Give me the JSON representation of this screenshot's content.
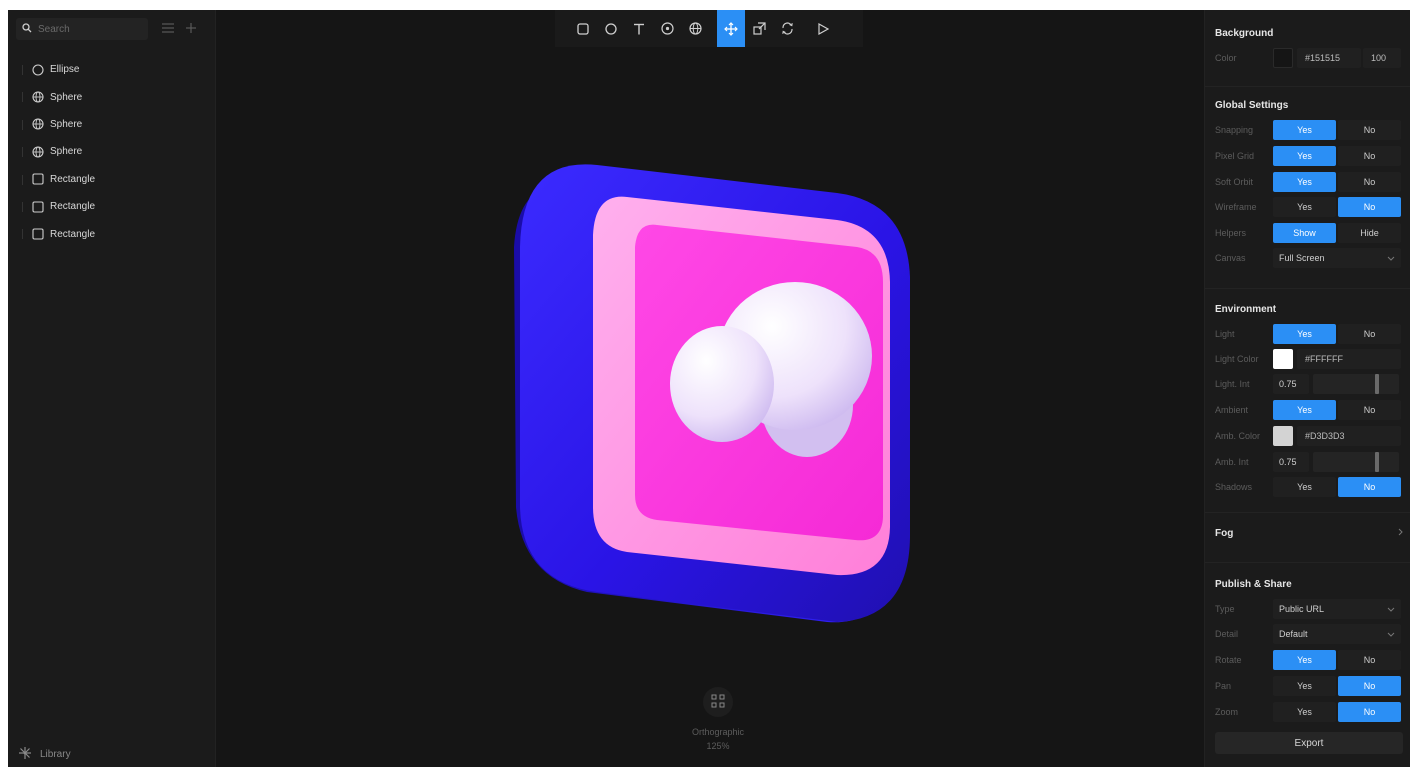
{
  "left_panel": {
    "search_placeholder": "Search",
    "layers": [
      {
        "label": "Ellipse",
        "icon": "ellipse-icon"
      },
      {
        "label": "Sphere",
        "icon": "sphere-icon"
      },
      {
        "label": "Sphere",
        "icon": "sphere-icon"
      },
      {
        "label": "Sphere",
        "icon": "sphere-icon"
      },
      {
        "label": "Rectangle",
        "icon": "rectangle-icon"
      },
      {
        "label": "Rectangle",
        "icon": "rectangle-icon"
      },
      {
        "label": "Rectangle",
        "icon": "rectangle-icon"
      }
    ],
    "library_label": "Library"
  },
  "toolbar": {
    "tools": [
      "rectangle-tool-icon",
      "ellipse-tool-icon",
      "text-tool-icon",
      "sphere-tool-icon",
      "globe-tool-icon",
      "move-tool-icon",
      "scale-tool-icon",
      "rotate-tool-icon",
      "play-icon"
    ],
    "active_tool": "move-tool-icon"
  },
  "canvas": {
    "view_mode": "Orthographic",
    "zoom": "125%"
  },
  "colors": {
    "accent": "#2b8ff5",
    "frame_blue": "#2a14e6",
    "pink_outer": "#ff8fe0",
    "pink_inner": "#ff3ee0",
    "cloud": "#e9dcf8"
  },
  "right_panel": {
    "background": {
      "title": "Background",
      "color_label": "Color",
      "color_value": "#151515",
      "opacity": "100"
    },
    "global_settings": {
      "title": "Global Settings",
      "snapping": {
        "label": "Snapping",
        "options": [
          "Yes",
          "No"
        ],
        "selected": "Yes"
      },
      "pixel_grid": {
        "label": "Pixel Grid",
        "options": [
          "Yes",
          "No"
        ],
        "selected": "Yes"
      },
      "soft_orbit": {
        "label": "Soft Orbit",
        "options": [
          "Yes",
          "No"
        ],
        "selected": "Yes"
      },
      "wireframe": {
        "label": "Wireframe",
        "options": [
          "Yes",
          "No"
        ],
        "selected": "No"
      },
      "helpers": {
        "label": "Helpers",
        "options": [
          "Show",
          "Hide"
        ],
        "selected": "Show"
      },
      "canvas": {
        "label": "Canvas",
        "value": "Full Screen"
      }
    },
    "environment": {
      "title": "Environment",
      "light": {
        "label": "Light",
        "options": [
          "Yes",
          "No"
        ],
        "selected": "Yes"
      },
      "light_color": {
        "label": "Light Color",
        "value": "#FFFFFF",
        "swatch": "#ffffff"
      },
      "light_int": {
        "label": "Light. Int",
        "value": "0.75",
        "fraction": 0.75
      },
      "ambient": {
        "label": "Ambient",
        "options": [
          "Yes",
          "No"
        ],
        "selected": "Yes"
      },
      "amb_color": {
        "label": "Amb. Color",
        "value": "#D3D3D3",
        "swatch": "#d3d3d3"
      },
      "amb_int": {
        "label": "Amb. Int",
        "value": "0.75",
        "fraction": 0.75
      },
      "shadows": {
        "label": "Shadows",
        "options": [
          "Yes",
          "No"
        ],
        "selected": "No"
      }
    },
    "fog": {
      "title": "Fog"
    },
    "publish": {
      "title": "Publish & Share",
      "type": {
        "label": "Type",
        "value": "Public URL"
      },
      "detail": {
        "label": "Detail",
        "value": "Default"
      },
      "rotate": {
        "label": "Rotate",
        "options": [
          "Yes",
          "No"
        ],
        "selected": "Yes"
      },
      "pan": {
        "label": "Pan",
        "options": [
          "Yes",
          "No"
        ],
        "selected": "No"
      },
      "zoom": {
        "label": "Zoom",
        "options": [
          "Yes",
          "No"
        ],
        "selected": "No"
      },
      "export_label": "Export"
    }
  }
}
